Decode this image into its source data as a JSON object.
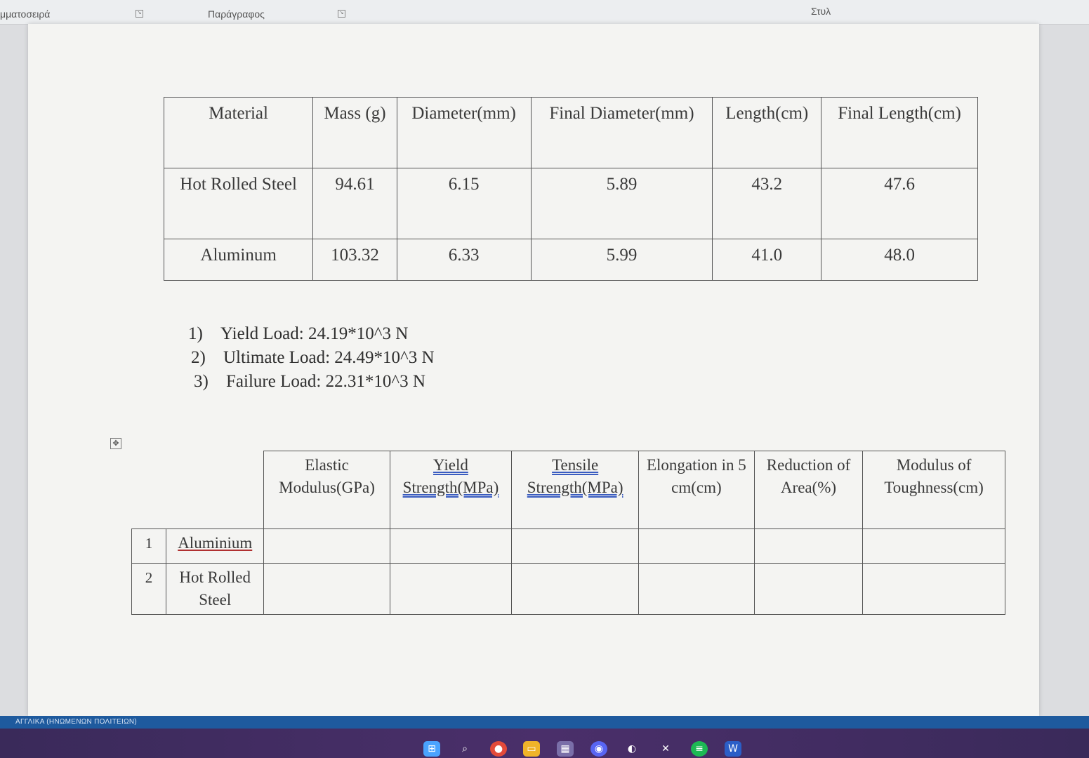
{
  "ribbon": {
    "font_group": "μματοσειρά",
    "paragraph_group": "Παράγραφος",
    "styles_group": "Στυλ"
  },
  "table1": {
    "headers": [
      "Material",
      "Mass (g)",
      "Diameter(mm)",
      "Final Diameter(mm)",
      "Length(cm)",
      "Final Length(cm)"
    ],
    "rows": [
      [
        "Hot Rolled Steel",
        "94.61",
        "6.15",
        "5.89",
        "43.2",
        "47.6"
      ],
      [
        "Aluminum",
        "103.32",
        "6.33",
        "5.99",
        "41.0",
        "48.0"
      ]
    ]
  },
  "loads": [
    {
      "num": "1)",
      "text": "Yield Load: 24.19*10^3 N"
    },
    {
      "num": "2)",
      "text": "Ultimate Load: 24.49*10^3 N"
    },
    {
      "num": "3)",
      "text": "Failure Load: 22.31*10^3 N"
    }
  ],
  "table2": {
    "headers": [
      "Elastic Modulus(GPa)",
      "Yield Strength(MPa)",
      "Tensile Strength(MPa)",
      "Elongation in 5 cm(cm)",
      "Reduction of Area(%)",
      "Modulus of Toughness(cm)"
    ],
    "rows": [
      {
        "num": "1",
        "material": "Aluminium"
      },
      {
        "num": "2",
        "material": "Hot Rolled Steel"
      }
    ]
  },
  "statusbar": {
    "text": "ΑΓΓΛΙΚΑ (ΗΝΩΜΕΝΩΝ ΠΟΛΙΤΕΙΩΝ)"
  },
  "taskbar": {
    "icons": [
      "start-icon",
      "search-icon",
      "chrome-icon",
      "file-explorer-icon",
      "store-icon",
      "discord-icon",
      "steam-icon",
      "xbox-icon",
      "spotify-icon",
      "word-icon"
    ]
  }
}
